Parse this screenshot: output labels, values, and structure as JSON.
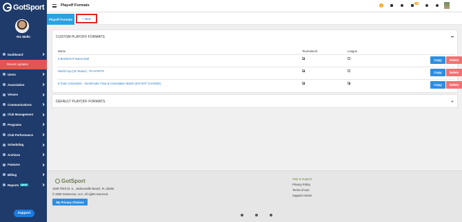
{
  "sidebar": {
    "logo": "GotSport",
    "user_name": "Ric Mello",
    "items": [
      {
        "label": "Dashboard"
      },
      {
        "label": "Recent Updates"
      },
      {
        "label": "Users"
      },
      {
        "label": "Association"
      },
      {
        "label": "Venues"
      },
      {
        "label": "Communications"
      },
      {
        "label": "Club Management"
      },
      {
        "label": "Programs"
      },
      {
        "label": "Club Performance"
      },
      {
        "label": "Scheduling"
      },
      {
        "label": "Archives"
      },
      {
        "label": "Features"
      },
      {
        "label": "Billing"
      },
      {
        "label": "Reports",
        "badge": "BETA"
      }
    ],
    "support_label": "Support"
  },
  "header": {
    "title": "Playoff Formats",
    "help_label": "?",
    "mail_count": "18"
  },
  "tabs": {
    "active_label": "Playoff Formats",
    "new_label": "+ New"
  },
  "custom_panel": {
    "title": "CUSTOM PLAYOFF FORMATS",
    "columns": {
      "name": "Name",
      "tournament": "Tournament",
      "league": "League"
    },
    "rows": [
      {
        "name": "3 Brackets 9 teams total",
        "tournament": true,
        "league": false
      },
      {
        "name": "World Cup (32 Teams) - PLAYOFFS",
        "tournament": true,
        "league": false
      },
      {
        "name": "6 Team 2 Brackets - SemiFinals, Final & Consolation Match (DO NOT CHANGE)",
        "tournament": true,
        "league": true
      }
    ],
    "copy_label": "Copy",
    "delete_label": "Delete"
  },
  "default_panel": {
    "title": "DEFAULT PLAYOFF FORMATS",
    "expand_label": "+"
  },
  "footer": {
    "logo": "GotSport",
    "address": "1029 Third St. S., Jacksonville Beach, FL 32250",
    "copyright": "© 2026 GotSoccer, LLC. All rights reserved.",
    "privacy_button": "My Privacy Choices",
    "links": [
      "Help & Support",
      "Privacy Policy",
      "Terms of Use",
      "Support Center"
    ]
  },
  "colors": {
    "sidebar": "#1f3b6b",
    "accent": "#2aa1e0",
    "highlight": "#e5231f",
    "delete": "#f07272"
  }
}
